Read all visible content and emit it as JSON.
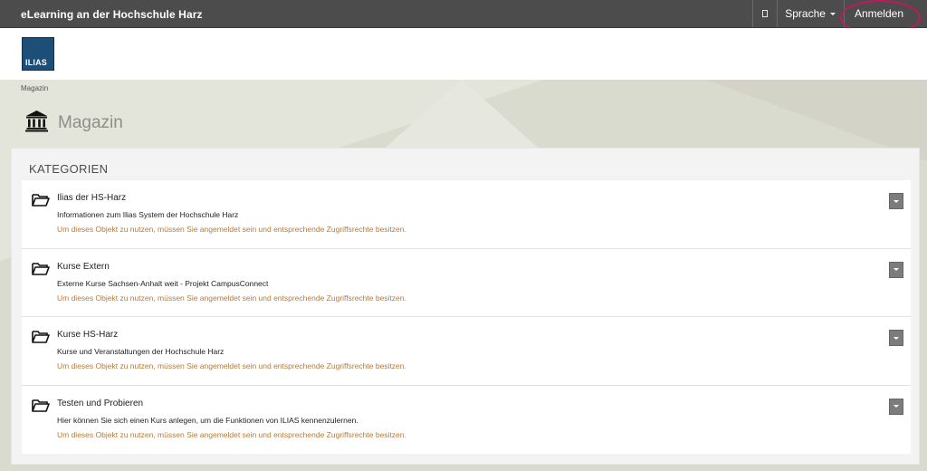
{
  "topbar": {
    "title": "eLearning an der Hochschule Harz",
    "icon": "square-icon",
    "language_label": "Sprache",
    "login_label": "Anmelden"
  },
  "header": {
    "logo_text": "ILIAS"
  },
  "breadcrumb": "Magazin",
  "page": {
    "title": "Magazin",
    "icon": "repository-building-icon"
  },
  "categories": {
    "heading": "KATEGORIEN",
    "items": [
      {
        "name": "Ilias der HS-Harz",
        "description": "Informationen zum Ilias System der Hochschule Harz",
        "notice": "Um dieses Objekt zu nutzen, müssen Sie angemeldet sein und entsprechende Zugriffsrechte besitzen."
      },
      {
        "name": "Kurse Extern",
        "description": "Externe Kurse Sachsen-Anhalt weit - Projekt CampusConnect",
        "notice": "Um dieses Objekt zu nutzen, müssen Sie angemeldet sein und entsprechende Zugriffsrechte besitzen."
      },
      {
        "name": "Kurse HS-Harz",
        "description": "Kurse und Veranstaltungen der Hochschule Harz",
        "notice": "Um dieses Objekt zu nutzen, müssen Sie angemeldet sein und entsprechende Zugriffsrechte besitzen."
      },
      {
        "name": "Testen und Probieren",
        "description": "Hier können Sie sich einen Kurs anlegen, um die Funktionen von ILIAS kennenzulernen.",
        "notice": "Um dieses Objekt zu nutzen, müssen Sie angemeldet sein und entsprechende Zugriffsrechte besitzen."
      }
    ]
  },
  "colors": {
    "topbar": "#4c4c4c",
    "accent_notice": "#b77a3a",
    "annotation": "#c2185b",
    "logo": "#1d4e77"
  }
}
